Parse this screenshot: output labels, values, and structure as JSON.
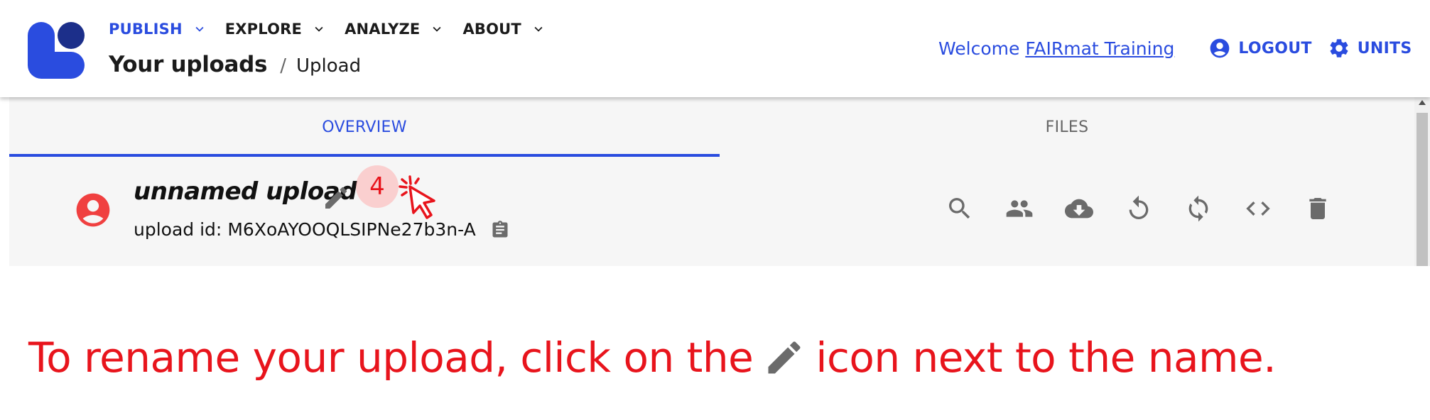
{
  "header": {
    "nav": [
      {
        "label": "PUBLISH",
        "active": true
      },
      {
        "label": "EXPLORE",
        "active": false
      },
      {
        "label": "ANALYZE",
        "active": false
      },
      {
        "label": "ABOUT",
        "active": false
      }
    ],
    "breadcrumb": {
      "title": "Your uploads",
      "separator": "/",
      "current": "Upload"
    },
    "welcome_prefix": "Welcome ",
    "user_name": "FAIRmat Training",
    "logout_label": "LOGOUT",
    "units_label": "UNITS"
  },
  "tabs": {
    "overview": "OVERVIEW",
    "files": "FILES",
    "active": "OVERVIEW"
  },
  "upload": {
    "name": "unnamed upload",
    "id_label": "upload id:",
    "id_value": "M6XoAYOOQLSIPNe27b3n-A"
  },
  "annotation": {
    "step_number": "4",
    "caption_before": "To rename your upload, click on the",
    "caption_after": "icon next to the name."
  },
  "icons": {
    "edit": "pencil-icon",
    "avatar": "account-circle-icon",
    "copy": "clipboard-icon",
    "actions": [
      "search-icon",
      "members-icon",
      "cloud-download-icon",
      "restore-icon",
      "reprocess-icon",
      "code-icon",
      "delete-icon"
    ]
  },
  "colors": {
    "brand_blue": "#2a4cdf",
    "logo_blue": "#2a4cdf",
    "logo_dark": "#1c2f8a",
    "annotation_red": "#e8141c",
    "avatar_red": "#f04040",
    "icon_gray": "#666666"
  }
}
